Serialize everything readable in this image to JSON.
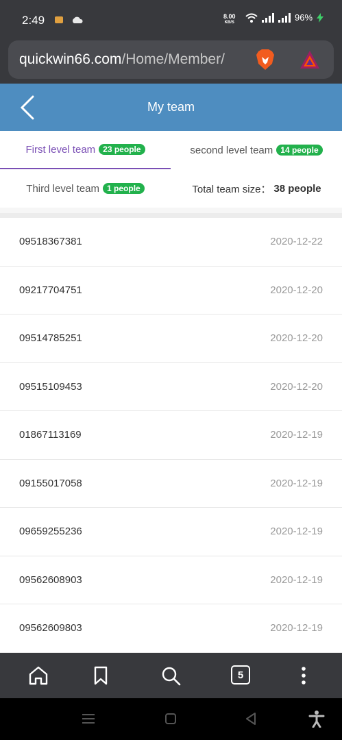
{
  "status": {
    "time": "2:49",
    "speed_value": "8.00",
    "speed_unit": "KB/S",
    "battery": "96%"
  },
  "browser": {
    "url_domain": "quickwin66.com",
    "url_path": "/Home/Member/",
    "tab_count": "5"
  },
  "header": {
    "title": "My team"
  },
  "tabs": {
    "first": {
      "label": "First level team",
      "badge": "23 people"
    },
    "second": {
      "label": "second level team",
      "badge": "14 people"
    },
    "third": {
      "label": "Third level team",
      "badge": "1 people"
    },
    "total_label": "Total team size：",
    "total_value": "38 people"
  },
  "members": [
    {
      "phone": "09518367381",
      "date": "2020-12-22"
    },
    {
      "phone": "09217704751",
      "date": "2020-12-20"
    },
    {
      "phone": "09514785251",
      "date": "2020-12-20"
    },
    {
      "phone": "09515109453",
      "date": "2020-12-20"
    },
    {
      "phone": "01867113169",
      "date": "2020-12-19"
    },
    {
      "phone": "09155017058",
      "date": "2020-12-19"
    },
    {
      "phone": "09659255236",
      "date": "2020-12-19"
    },
    {
      "phone": "09562608903",
      "date": "2020-12-19"
    },
    {
      "phone": "09562609803",
      "date": "2020-12-19"
    }
  ],
  "colors": {
    "header": "#4e8dc0",
    "active_tab": "#7a4fb5",
    "badge": "#22b14c",
    "chrome": "#38393d"
  },
  "icons": [
    "back-arrow-icon",
    "brave-lion-icon",
    "bat-triangle-icon",
    "home-icon",
    "bookmark-icon",
    "search-icon",
    "tabs-icon",
    "more-vertical-icon"
  ]
}
